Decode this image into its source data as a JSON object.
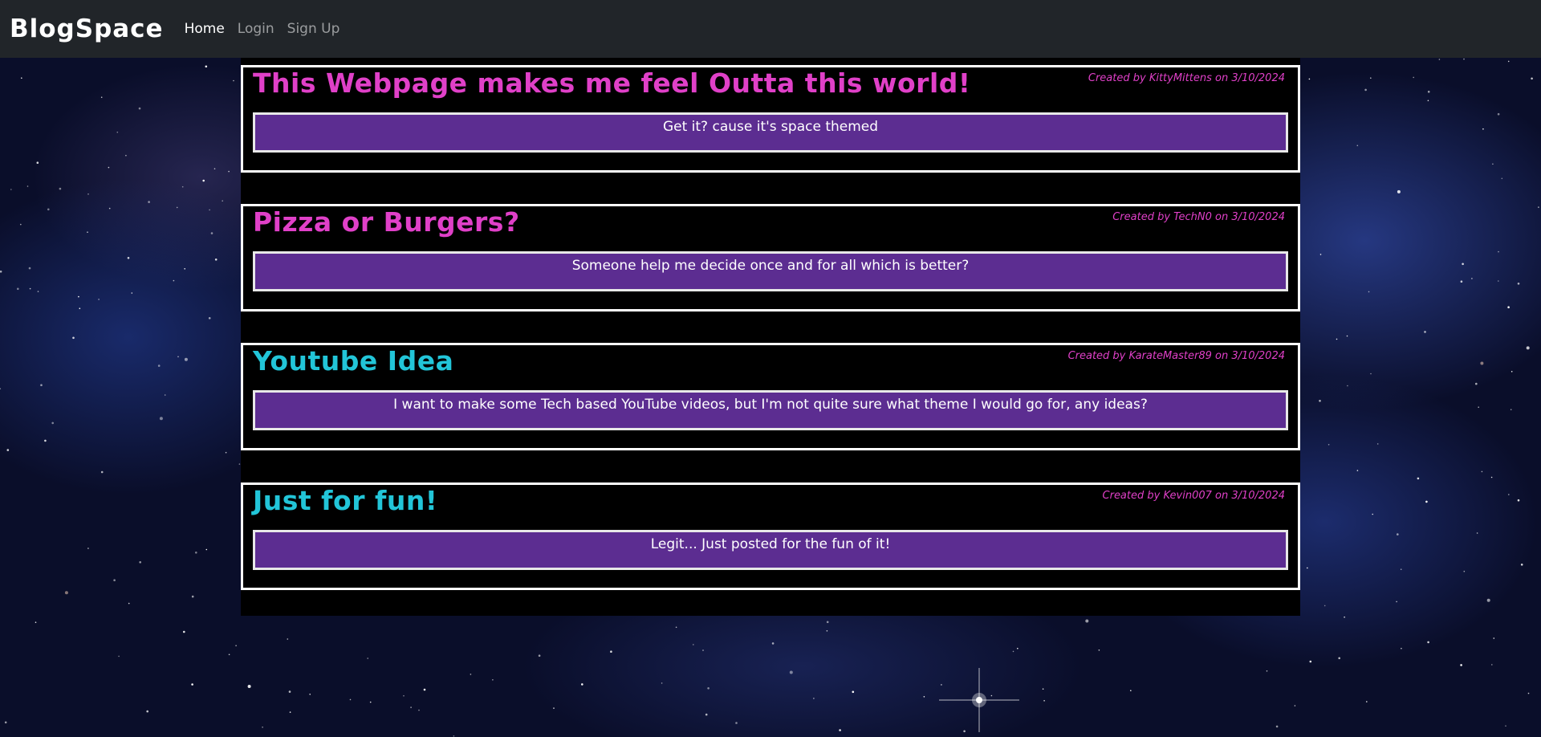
{
  "navbar": {
    "brand": "BlogSpace",
    "links": [
      {
        "label": "Home",
        "active": true
      },
      {
        "label": "Login",
        "active": false
      },
      {
        "label": "Sign Up",
        "active": false
      }
    ]
  },
  "posts": [
    {
      "title": "This Webpage makes me feel Outta this world!",
      "meta": "Created by KittyMittens on 3/10/2024",
      "body": "Get it? cause it's space themed",
      "color": "#e040c8"
    },
    {
      "title": "Pizza or Burgers?",
      "meta": "Created by TechN0 on 3/10/2024",
      "body": "Someone help me decide once and for all which is better?",
      "color": "#e040c8"
    },
    {
      "title": "Youtube Idea",
      "meta": "Created by KarateMaster89 on 3/10/2024",
      "body": "I want to make some Tech based YouTube videos, but I'm not quite sure what theme I would go for, any ideas?",
      "color": "#22c5d8"
    },
    {
      "title": "Just for fun!",
      "meta": "Created by Kevin007 on 3/10/2024",
      "body": "Legit... Just posted for the fun of it!",
      "color": "#22c5d8"
    }
  ],
  "meta_color": "#e040c8",
  "colors": {
    "navbar_bg": "#212529",
    "post_body_bg": "#5c2d91",
    "pink_title": "#e040c8",
    "cyan_title": "#22c5d8"
  }
}
